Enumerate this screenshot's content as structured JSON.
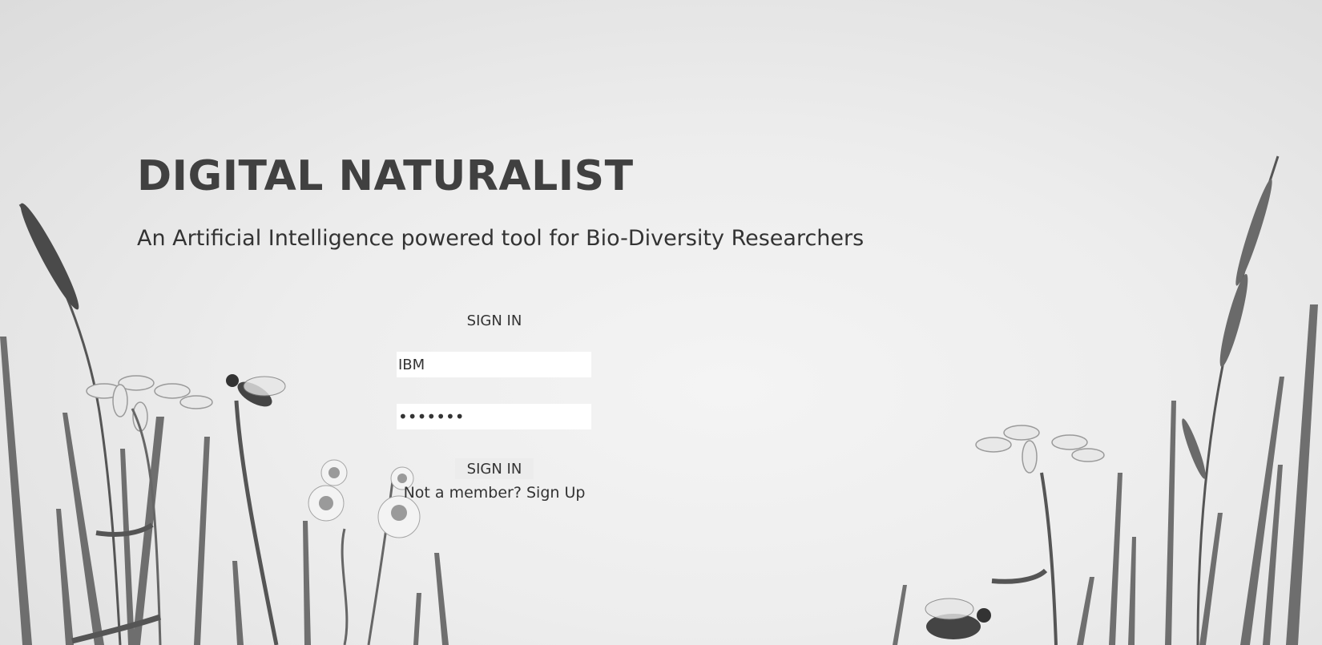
{
  "header": {
    "title": "DIGITAL NATURALIST",
    "subtitle": "An Artificial Intelligence powered tool for Bio-Diversity Researchers"
  },
  "login": {
    "heading": "SIGN IN",
    "username_value": "IBM",
    "password_value": "•••••••",
    "submit_label": "SIGN IN",
    "signup_prompt": "Not a member?",
    "signup_link": "Sign Up"
  },
  "colors": {
    "background": "#ededed",
    "text": "#333333",
    "field_background": "#ffffff"
  }
}
